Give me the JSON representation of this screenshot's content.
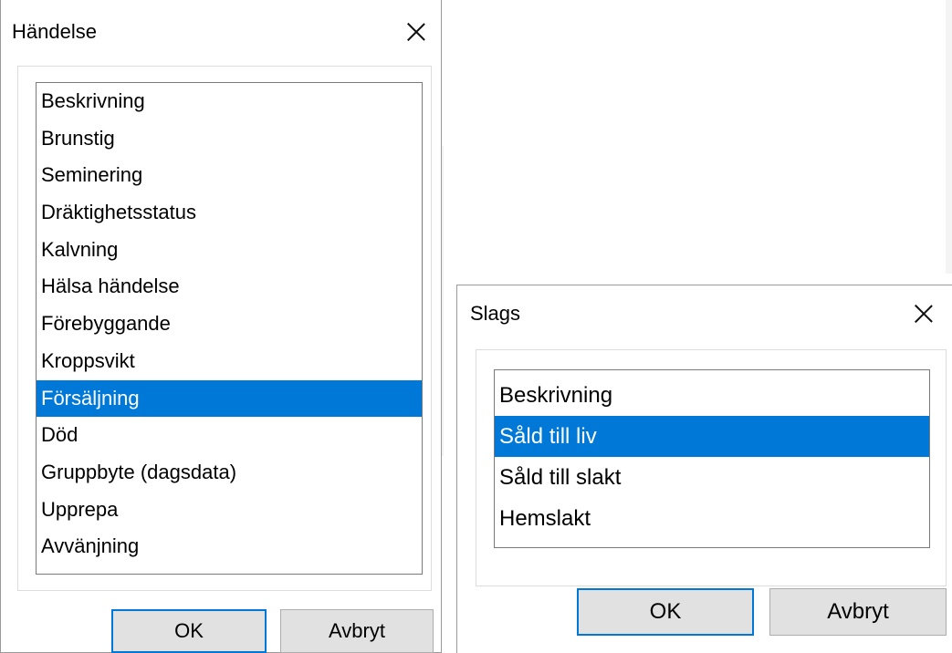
{
  "dialog_handelse": {
    "title": "Händelse",
    "items": [
      "Beskrivning",
      "Brunstig",
      "Seminering",
      "Dräktighetsstatus",
      "Kalvning",
      "Hälsa händelse",
      "Förebyggande",
      "Kroppsvikt",
      "Försäljning",
      "Död",
      "Gruppbyte (dagsdata)",
      "Upprepa",
      "Avvänjning"
    ],
    "selected": "Försäljning",
    "ok_label": "OK",
    "cancel_label": "Avbryt"
  },
  "dialog_slags": {
    "title": "Slags",
    "items": [
      "Beskrivning",
      "Såld till liv",
      "Såld till slakt",
      "Hemslakt"
    ],
    "selected": "Såld till liv",
    "ok_label": "OK",
    "cancel_label": "Avbryt"
  },
  "colors": {
    "selection": "#0078d7",
    "button_face": "#e1e1e1"
  },
  "icons": {
    "close": "close-icon"
  }
}
